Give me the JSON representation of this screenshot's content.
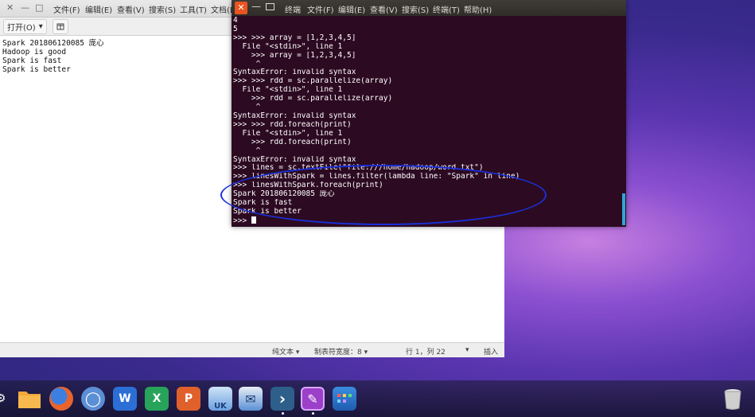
{
  "gedit": {
    "title_controls": {
      "close": "✕",
      "minimize": "—",
      "maximize": "□"
    },
    "menu": [
      "文件(F)",
      "编辑(E)",
      "查看(V)",
      "搜索(S)",
      "工具(T)",
      "文档(D"
    ],
    "toolbar": {
      "open_label": "打开(O)",
      "open_dropdown": "▾"
    },
    "text_lines": [
      "Spark 201806120085 庞心",
      "Hadoop is good",
      "Spark is fast",
      "Spark is better"
    ],
    "statusbar": {
      "language": "纯文本 ▾",
      "tab_width": "制表符宽度：8 ▾",
      "cursor_position": "行 1，列 22",
      "dropdown": "▾",
      "insert_mode": "插入"
    }
  },
  "terminal": {
    "menu": [
      "终端",
      "文件(F)",
      "编辑(E)",
      "查看(V)",
      "搜索(S)",
      "终端(T)",
      "帮助(H)"
    ],
    "output_lines": [
      "4",
      "5",
      ">>> >>> array = [1,2,3,4,5]",
      "  File \"<stdin>\", line 1",
      "    >>> array = [1,2,3,4,5]",
      "     ^",
      "SyntaxError: invalid syntax",
      ">>> >>> rdd = sc.parallelize(array)",
      "  File \"<stdin>\", line 1",
      "    >>> rdd = sc.parallelize(array)",
      "     ^",
      "SyntaxError: invalid syntax",
      ">>> >>> rdd.foreach(print)",
      "  File \"<stdin>\", line 1",
      "    >>> rdd.foreach(print)",
      "     ^",
      "SyntaxError: invalid syntax",
      ">>> lines = sc.textFile(\"file:///home/hadoop/word.txt\")",
      ">>> linesWithSpark = lines.filter(lambda line: \"Spark\" in line)",
      ">>> linesWithSpark.foreach(print)",
      "Spark 201806120085 庞心",
      "Spark is fast",
      "Spark is better"
    ],
    "prompt": ">>> "
  },
  "dock": {
    "icons": [
      {
        "name": "settings-app-icon",
        "glyph": "⚙",
        "color": "#3a3a3a"
      },
      {
        "name": "files-app-icon",
        "glyph": "",
        "color": "#f0a030"
      },
      {
        "name": "firefox-app-icon",
        "glyph": "",
        "color": "#e8642c"
      },
      {
        "name": "chrome-app-icon",
        "glyph": "◯",
        "color": "#5b8fd6"
      },
      {
        "name": "wps-writer-app-icon",
        "glyph": "W",
        "color": "#2b6fd6"
      },
      {
        "name": "wps-spreadsheet-app-icon",
        "glyph": "X",
        "color": "#27a35a"
      },
      {
        "name": "wps-presentation-app-icon",
        "glyph": "P",
        "color": "#e0602b"
      },
      {
        "name": "ukylin-app-icon",
        "glyph": "UK",
        "color": "#6aa0e0"
      },
      {
        "name": "mail-app-icon",
        "glyph": "✉",
        "color": "#5b8fd6"
      },
      {
        "name": "terminal-app-icon",
        "glyph": "›",
        "color": "#2d5f8a"
      },
      {
        "name": "text-editor-app-icon",
        "glyph": "✎",
        "color": "#9c3fc9"
      },
      {
        "name": "app-grid-icon",
        "glyph": "",
        "color": "#2e74c9"
      },
      {
        "name": "trash-icon",
        "glyph": "",
        "color": "#d0d0d0"
      }
    ]
  }
}
